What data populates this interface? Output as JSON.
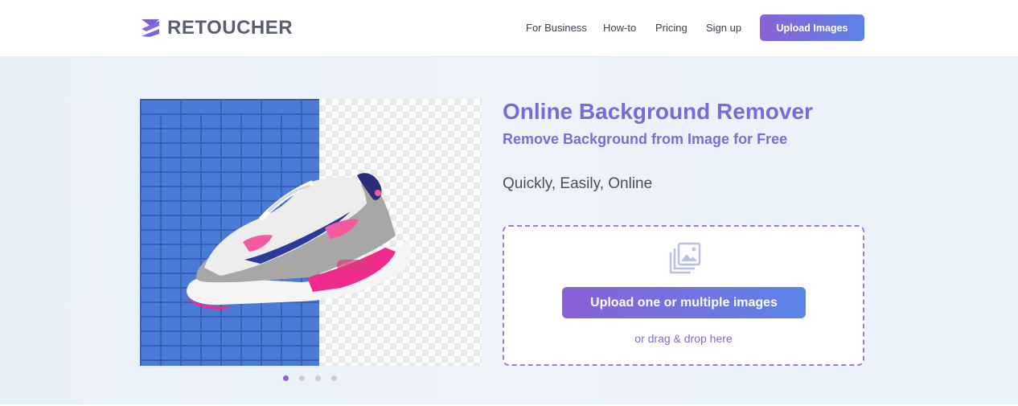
{
  "header": {
    "logo_text": "RETOUCHER",
    "nav": [
      "For Business",
      "How-to",
      "Pricing",
      "Sign up"
    ],
    "upload_button": "Upload Images"
  },
  "hero": {
    "title": "Online Background Remover",
    "subtitle": "Remove Background from Image for Free",
    "tagline": "Quickly, Easily, Online",
    "dropzone": {
      "button": "Upload one or multiple images",
      "hint": "or drag & drop here"
    },
    "carousel": {
      "slides": 4,
      "active": 1
    }
  },
  "colors": {
    "accent": "#7b68db",
    "button_start": "#8a61d6",
    "button_end": "#5b83e8",
    "dash_border": "#9d79d6"
  },
  "icons": [
    "retoucher-logo-icon",
    "images-stack-icon"
  ]
}
